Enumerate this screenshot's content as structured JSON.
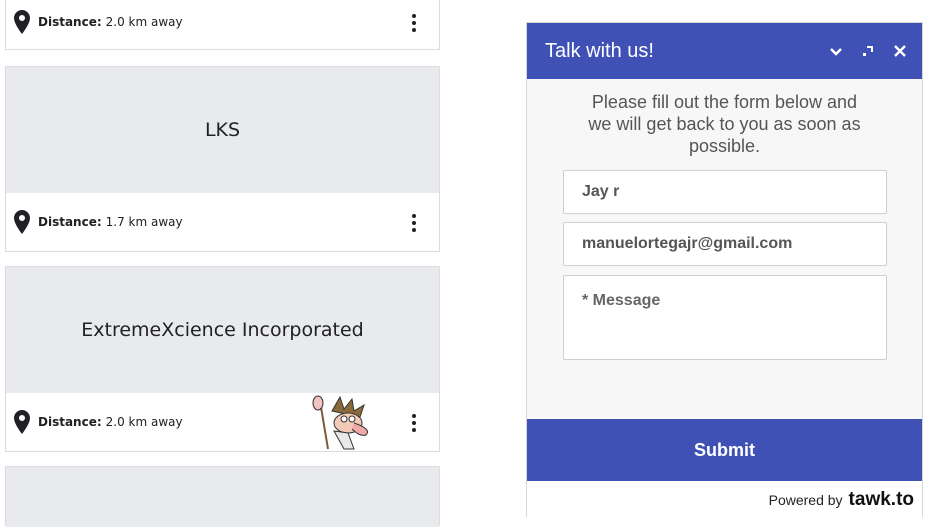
{
  "cards": [
    {
      "name": "",
      "distance_label": "Distance:",
      "distance_value": "2.0 km away"
    },
    {
      "name": "LKS",
      "distance_label": "Distance:",
      "distance_value": "1.7 km away"
    },
    {
      "name": "ExtremeXcience Incorporated",
      "distance_label": "Distance:",
      "distance_value": "2.0 km away"
    }
  ],
  "chat": {
    "title": "Talk with us!",
    "intro": "Please fill out the form below and we will get back to you as soon as possible.",
    "name_value": "Jay r",
    "email_value": "manuelortegajr@gmail.com",
    "message_placeholder": "* Message",
    "submit_label": "Submit",
    "powered_by": "Powered by",
    "brand": "tawk.to"
  },
  "colors": {
    "accent": "#3f51b5",
    "banner": "#e9eaed"
  }
}
